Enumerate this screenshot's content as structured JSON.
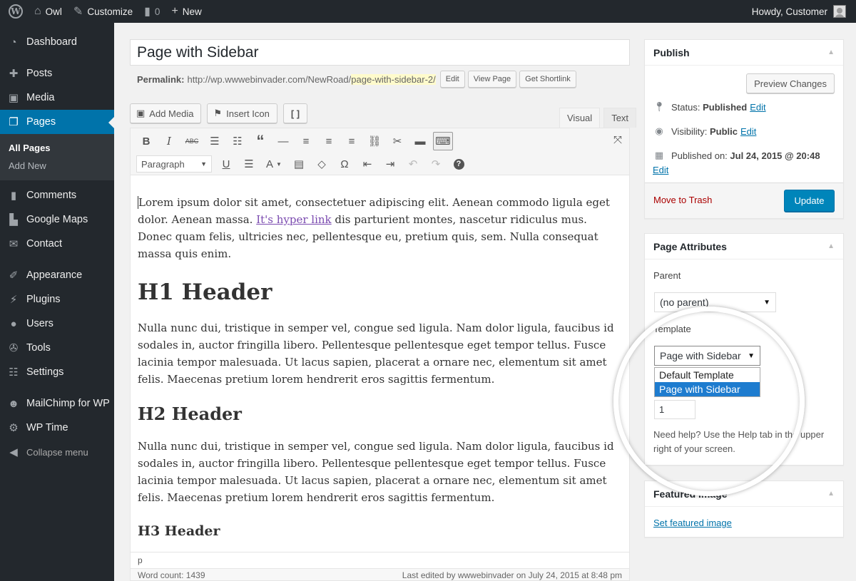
{
  "admin_bar": {
    "site_name": "Owl",
    "customize": "Customize",
    "comments_count": "0",
    "new_label": "New",
    "greeting": "Howdy, Customer"
  },
  "sidebar": {
    "dashboard": "Dashboard",
    "posts": "Posts",
    "media": "Media",
    "pages": "Pages",
    "pages_sub": [
      "All Pages",
      "Add New"
    ],
    "comments": "Comments",
    "google_maps": "Google Maps",
    "contact": "Contact",
    "appearance": "Appearance",
    "plugins": "Plugins",
    "users": "Users",
    "tools": "Tools",
    "settings": "Settings",
    "mailchimp": "MailChimp for WP",
    "wp_time": "WP Time",
    "collapse": "Collapse menu"
  },
  "editor": {
    "title_value": "Page with Sidebar",
    "permalink_label": "Permalink:",
    "permalink_base": "http://wp.wwwebinvader.com/NewRoad/",
    "permalink_slug": "page-with-sidebar-2/",
    "permalink_buttons": [
      "Edit",
      "View Page",
      "Get Shortlink"
    ],
    "add_media": "Add Media",
    "insert_icon": "Insert Icon",
    "code_button": "[ ]",
    "tabs": [
      "Visual",
      "Text"
    ],
    "format_select": "Paragraph",
    "content": {
      "p1_before_link": "Lorem ipsum dolor sit amet, consectetuer adipiscing elit. Aenean commodo ligula eget dolor. Aenean massa. ",
      "p1_link": "It's hyper link",
      "p1_after_link": " dis parturient montes, nascetur ridiculus mus. Donec quam felis, ultricies nec, pellentesque eu, pretium quis, sem. Nulla consequat massa quis enim.",
      "h1": "H1 Header",
      "p2": "Nulla nunc dui, tristique in semper vel, congue sed ligula. Nam dolor ligula, faucibus id sodales in, auctor fringilla libero. Pellentesque pellentesque eget tempor tellus. Fusce lacinia tempor malesuada. Ut lacus sapien, placerat a ornare nec, elementum sit amet felis. Maecenas pretium lorem hendrerit eros sagittis fermentum.",
      "h2": "H2 Header",
      "p3": "Nulla nunc dui, tristique in semper vel, congue sed ligula. Nam dolor ligula, faucibus id sodales in, auctor fringilla libero. Pellentesque pellentesque eget tempor tellus. Fusce lacinia tempor malesuada. Ut lacus sapien, placerat a ornare nec, elementum sit amet felis. Maecenas pretium lorem hendrerit eros sagittis fermentum.",
      "h3": "H3 Header"
    },
    "path": "p",
    "word_count": "Word count: 1439",
    "last_edited": "Last edited by wwwebinvader on July 24, 2015 at 8:48 pm"
  },
  "publish": {
    "title": "Publish",
    "preview": "Preview Changes",
    "status_label": "Status:",
    "status_value": "Published",
    "visibility_label": "Visibility:",
    "visibility_value": "Public",
    "published_label": "Published on:",
    "published_value": "Jul 24, 2015 @ 20:48",
    "edit": "Edit",
    "trash": "Move to Trash",
    "update": "Update"
  },
  "attributes": {
    "title": "Page Attributes",
    "parent_label": "Parent",
    "parent_value": "(no parent)",
    "template_label": "Template",
    "template_value": "Page with Sidebar",
    "template_options": [
      "Default Template",
      "Page with Sidebar"
    ],
    "order_value": "1",
    "help": "Need help? Use the Help tab in the upper right of your screen."
  },
  "featured": {
    "title": "Featured Image",
    "set_link": "Set featured image"
  },
  "colors": {
    "admin_dark": "#23282d",
    "accent": "#0073aa",
    "update_button": "#0085ba",
    "trash_red": "#a00",
    "slug_highlight": "#fffbcc"
  }
}
